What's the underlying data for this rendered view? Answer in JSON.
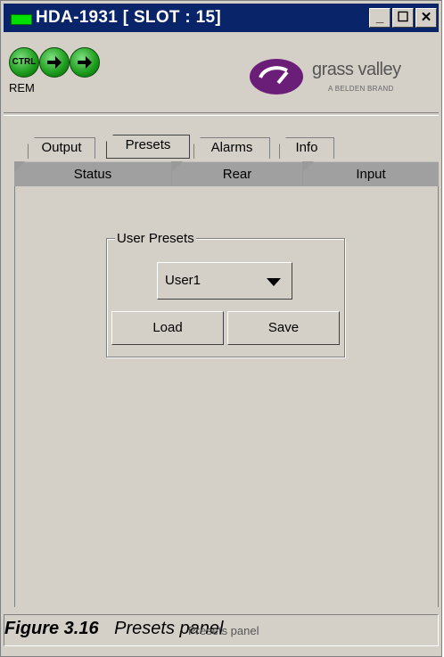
{
  "window": {
    "title": "HDA-1931 [ SLOT : 15]",
    "controls": [
      "minimize",
      "maximize",
      "close"
    ]
  },
  "header": {
    "status_indicators": [
      "CTRL",
      "arrow",
      "arrow"
    ],
    "remote_label": "REM",
    "logo": {
      "brand": "grass valley",
      "tagline": "A BELDEN BRAND"
    }
  },
  "tabs": {
    "row_top": [
      {
        "label": "Output"
      },
      {
        "label": "Presets",
        "active": true
      },
      {
        "label": "Alarms"
      },
      {
        "label": "Info"
      }
    ],
    "row_bottom": [
      {
        "label": "Status"
      },
      {
        "label": "Rear"
      },
      {
        "label": "Input"
      }
    ]
  },
  "presets_panel": {
    "group_label": "User Presets",
    "selected_preset": "User1",
    "load_label": "Load",
    "save_label": "Save"
  },
  "caption": {
    "figure": "Figure 3.16",
    "text": "Presets panel",
    "status_text": "Presets panel"
  },
  "colors": {
    "titlebar": "#0a246a",
    "panel": "#d4d0c8",
    "status_led": "#00e000",
    "indicator_green": "#1a9a1a",
    "logo_purple": "#6a1e78"
  }
}
